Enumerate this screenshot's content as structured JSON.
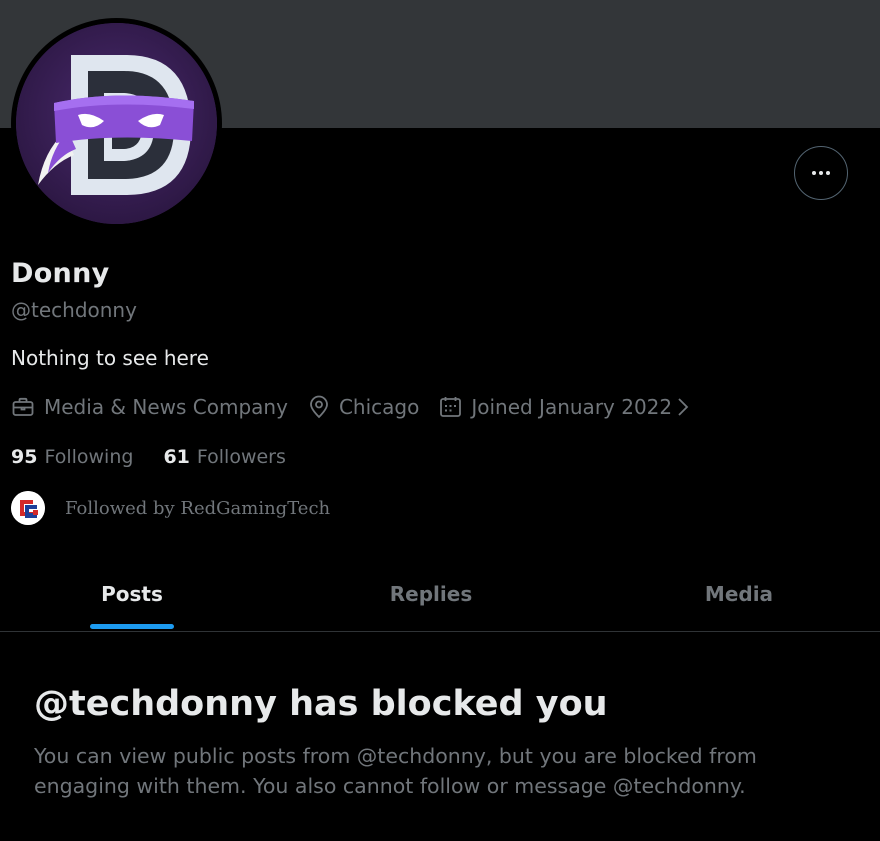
{
  "profile": {
    "display_name": "Donny",
    "handle": "@techdonny",
    "bio": "Nothing to see here",
    "category": "Media & News Company",
    "location": "Chicago",
    "joined": "Joined January 2022",
    "following_count": "95",
    "following_label": "Following",
    "followers_count": "61",
    "followers_label": "Followers",
    "followed_by": "Followed by RedGamingTech"
  },
  "icons": {
    "category": "briefcase-icon",
    "location": "location-pin-icon",
    "joined": "calendar-icon",
    "more": "more-horizontal-icon"
  },
  "tabs": [
    {
      "label": "Posts",
      "active": true
    },
    {
      "label": "Replies",
      "active": false
    },
    {
      "label": "Media",
      "active": false
    }
  ],
  "blocked": {
    "title": "@techdonny has blocked you",
    "description": "You can view public posts from @techdonny, but you are blocked from engaging with them. You also cannot follow or message @techdonny."
  },
  "colors": {
    "background": "#000000",
    "banner": "#333639",
    "accent": "#1d9bf0",
    "text_primary": "#e7e9ea",
    "text_secondary": "#71767b",
    "avatar_purple": "#8a4fd6"
  }
}
